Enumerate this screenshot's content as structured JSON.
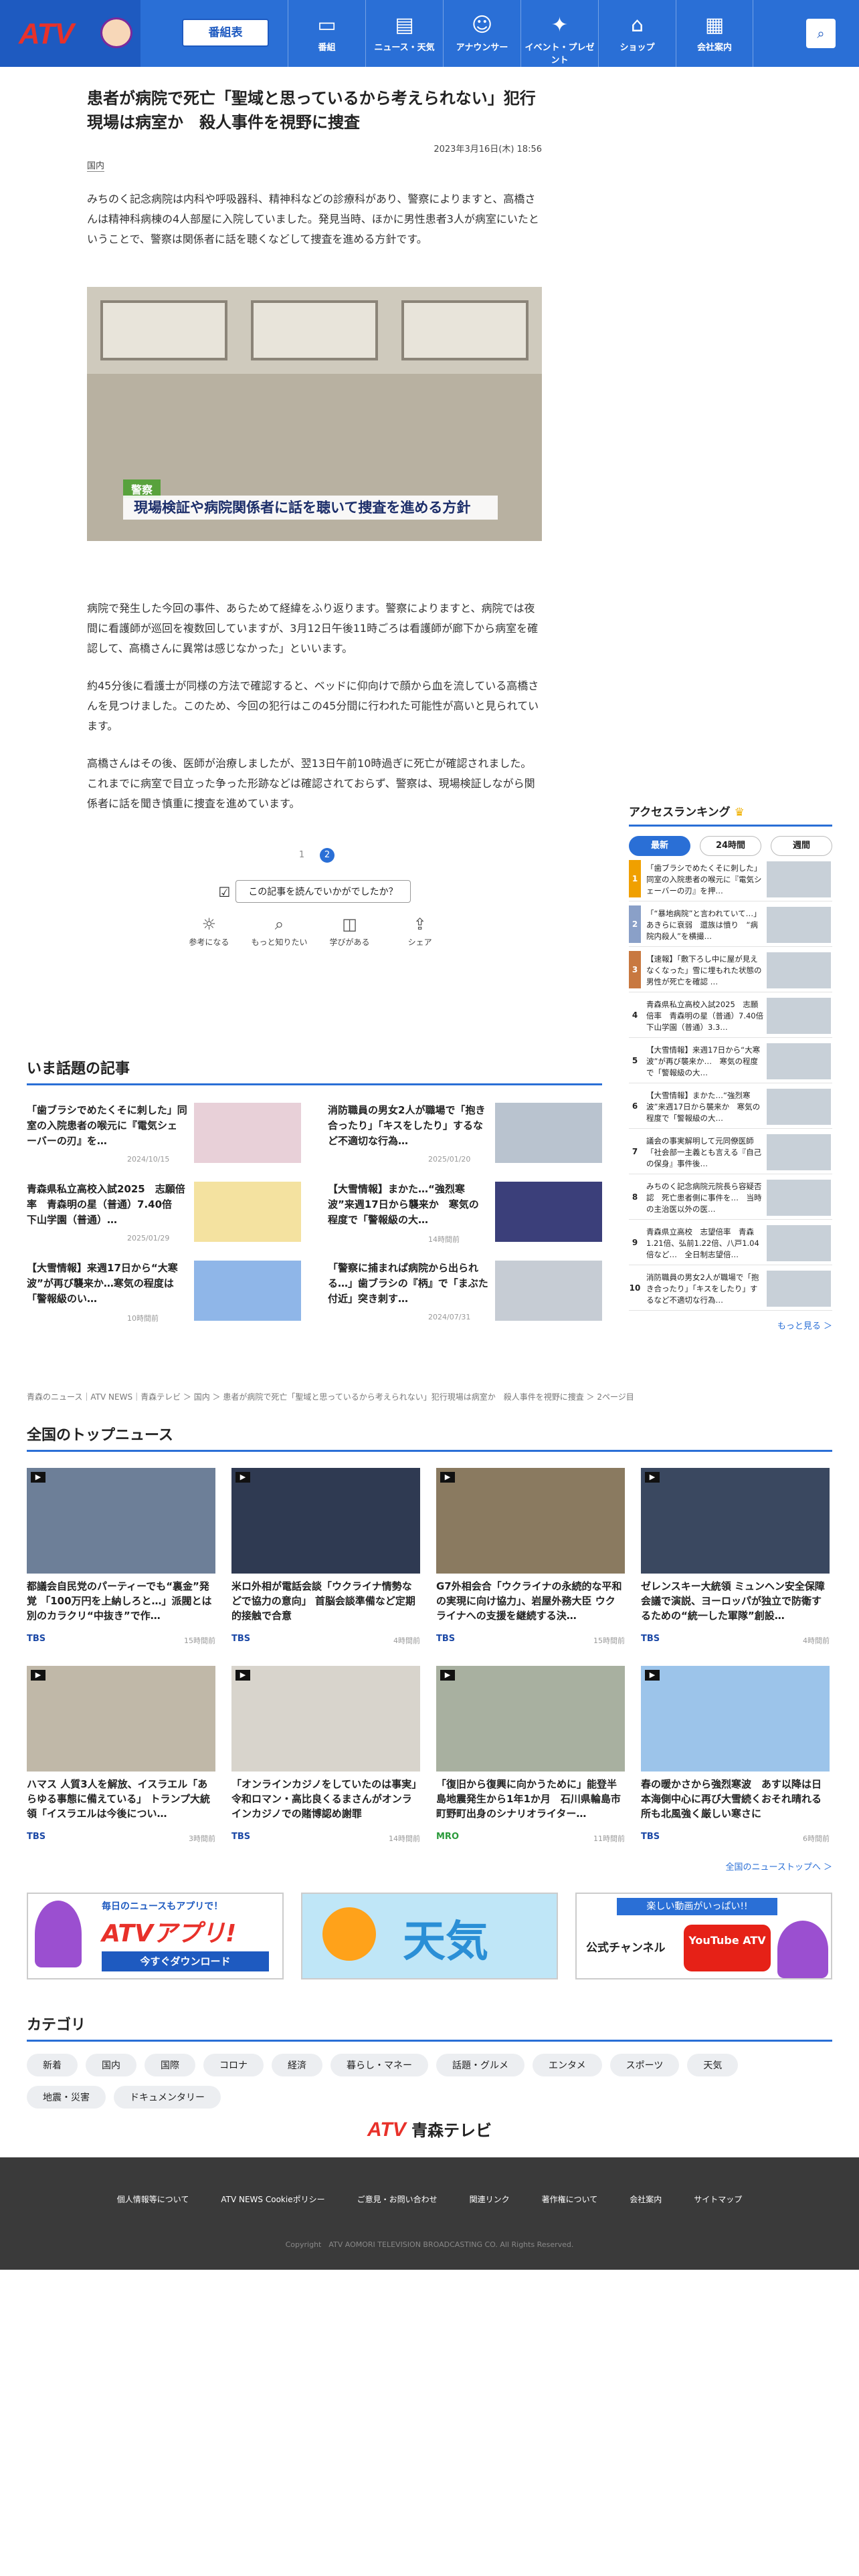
{
  "header": {
    "logo": "ATV",
    "program_button": "番組表",
    "nav": [
      {
        "label": "番組",
        "icon": "tv-icon"
      },
      {
        "label": "ニュース・天気",
        "icon": "news-icon"
      },
      {
        "label": "アナウンサー",
        "icon": "announcer-icon"
      },
      {
        "label": "イベント・プレゼント",
        "icon": "event-icon"
      },
      {
        "label": "ショップ",
        "icon": "shop-icon"
      },
      {
        "label": "会社案内",
        "icon": "building-icon"
      }
    ],
    "search_icon": "search-icon"
  },
  "article": {
    "title": "患者が病院で死亡「聖域と思っているから考えられない」犯行現場は病室か　殺人事件を視野に捜査",
    "date": "2023年3月16日(木) 18:56",
    "category": "国内",
    "para1": "みちのく記念病院は内科や呼吸器科、精神科などの診療科があり、警察によりますと、高橋さんは精神科病棟の4人部屋に入院していました。発見当時、ほかに男性患者3人が病室にいたということで、警察は関係者に話を聴くなどして捜査を進める方針です。",
    "photo_tag": "警察",
    "photo_caption": "現場検証や病院関係者に話を聴いて捜査を進める方針",
    "para2": "病院で発生した今回の事件、あらためて経緯をふり返ります。警察によりますと、病院では夜間に看護師が巡回を複数回していますが、3月12日午後11時ごろは看護師が廊下から病室を確認して、高橋さんに異常は感じなかった」といいます。",
    "para3": "約45分後に看護士が同様の方法で確認すると、ベッドに仰向けで顔から血を流している高橋さんを見つけました。このため、今回の犯行はこの45分間に行われた可能性が高いと見られています。",
    "para4": "高橋さんはその後、医師が治療しましたが、翌13日午前10時過ぎに死亡が確認されました。これまでに病室で目立った争った形跡などは確認されておらず、警察は、現場検証しながら関係者に話を聞き慎重に捜査を進めています。",
    "pages": [
      "1",
      "2"
    ],
    "question": "この記事を読んでいかがでしたか？",
    "reactions": [
      "参考になる",
      "もっと知りたい",
      "学びがある",
      "シェア"
    ]
  },
  "ima": {
    "title": "いま話題の記事",
    "items": [
      {
        "title": "「歯ブラシでめたくそに刺した」同室の入院患者の喉元に『電気シェーバーの刃』を…",
        "date": "2024/10/15"
      },
      {
        "title": "消防職員の男女2人が職場で「抱き合ったり」「キスをしたり」するなど不適切な行為…",
        "date": "2025/01/20"
      },
      {
        "title": "青森県私立高校入試2025　志願倍率　青森明の星（普通）7.40倍　下山学園（普通）…",
        "date": "2025/01/29"
      },
      {
        "title": "【大雪情報】まかた…“強烈寒波”来週17日から襲来か　寒気の程度で「警報級の大…",
        "date": "14時間前"
      },
      {
        "title": "【大雪情報】来週17日から“大寒波”が再び襲来か…寒気の程度は「警報級のい…",
        "date": "10時間前"
      },
      {
        "title": "「警察に捕まれば病院から出られる…」歯ブラシの『柄』で「まぶた付近」突き刺す…",
        "date": "2024/07/31"
      }
    ]
  },
  "breadcrumb": "青森のニュース｜ATV NEWS｜青森テレビ ＞ 国内 ＞ 患者が病院で死亡「聖域と思っているから考えられない」犯行現場は病室か　殺人事件を視野に捜査 ＞ 2ページ目",
  "ranking": {
    "title": "アクセスランキング",
    "tabs": [
      "最新",
      "24時間",
      "週間"
    ],
    "items": [
      {
        "n": "1",
        "title": "「歯ブラシでめたくそに刺した」同室の入院患者の喉元に『電気シェーバーの刃』を押…"
      },
      {
        "n": "2",
        "title": "「“暴地病院”と言われていて…」あきらに衰弱　還族は憤り　“病院内殺人”を横撮…"
      },
      {
        "n": "3",
        "title": "【速報】「敷下ろし中に屋が見えなくなった」雪に埋もれた状態の男性が死亡を確認 …"
      },
      {
        "n": "4",
        "title": "青森県私立高校入試2025　志願倍率　青森明の星（普通）7.40倍　下山学園（普通）3.3…"
      },
      {
        "n": "5",
        "title": "【大雪情報】来週17日から“大寒波”が再び襲来か…　寒気の程度で「警報級の大…"
      },
      {
        "n": "6",
        "title": "【大雪情報】まかた…“強烈寒波”来週17日から襲来か　寒気の程度で「警報級の大…"
      },
      {
        "n": "7",
        "title": "議会の事実解明して元同僚医師「社会部一主義とも言える『自己の保身』事件後…"
      },
      {
        "n": "8",
        "title": "みちのく記念病院元院長ら容疑否認　死亡患者側に事件を…　当時の主治医以外の医…"
      },
      {
        "n": "9",
        "title": "青森県立高校　志望倍率　青森1.21倍、弘前1.22倍、八戸1.04倍など…　全日制志望倍…"
      },
      {
        "n": "10",
        "title": "消防職員の男女2人が職場で「抱き合ったり」「キスをしたり」するなど不適切な行為…"
      }
    ],
    "more": "もっと見る ＞"
  },
  "top": {
    "title": "全国のトップニュース",
    "items": [
      {
        "title": "都議会自民党のパーティーでも“裏金”発覚 「100万円を上納しろと…」派閥とは別のカラクリ“中抜き”で作…",
        "src": "TBS",
        "date": "15時間前"
      },
      {
        "title": "米ロ外相が電話会談「ウクライナ情勢などで協力の意向」 首脳会談準備など定期的接触で合意",
        "src": "TBS",
        "date": "4時間前"
      },
      {
        "title": "G7外相会合「ウクライナの永続的な平和の実現に向け協力」、岩屋外務大臣 ウクライナへの支援を継続する決…",
        "src": "TBS",
        "date": "15時間前"
      },
      {
        "title": "ゼレンスキー大統領 ミュンヘン安全保障会議で演説、ヨーロッパが独立で防衛するための“統一した軍隊”創設…",
        "src": "TBS",
        "date": "4時間前"
      },
      {
        "title": "ハマス 人質3人を解放、イスラエル「あらゆる事態に備えている」 トランプ大統領「イスラエルは今後につい…",
        "src": "TBS",
        "date": "3時間前"
      },
      {
        "title": "「オンラインカジノをしていたのは事実」令和ロマン・高比良くるまさんがオンラインカジノでの賭博認め謝罪",
        "src": "TBS",
        "date": "14時間前"
      },
      {
        "title": "「復旧から復興に向かうために」能登半島地震発生から1年1か月　石川県輪島市町野町出身のシナリオライター…",
        "src": "MRO",
        "date": "11時間前"
      },
      {
        "title": "春の暖かさから強烈寒波　あす以降は日本海側中心に再び大雪続くおそれ晴れる所も北風強く厳しい寒さに",
        "src": "TBS",
        "date": "6時間前"
      }
    ],
    "more": "全国のニューストップへ ＞"
  },
  "banners": [
    {
      "line1": "毎日のニュースもアプリで！",
      "line2": "ATVアプリ!",
      "line3": "今すぐダウンロード"
    },
    {
      "line1": "天気"
    },
    {
      "line1": "楽しい動画がいっぱい!!",
      "line2": "公式チャンネル",
      "line3": "YouTube ATV"
    }
  ],
  "categories": {
    "title": "カテゴリ",
    "items": [
      "新着",
      "国内",
      "国際",
      "コロナ",
      "経済",
      "暮らし・マネー",
      "話題・グルメ",
      "エンタメ",
      "スポーツ",
      "天気",
      "地震・災害",
      "ドキュメンタリー"
    ]
  },
  "footer": {
    "logo": "ATV",
    "logo_sub": "青森テレビ",
    "links": [
      "個人情報等について",
      "ATV NEWS Cookieポリシー",
      "ご意見・お問い合わせ",
      "関連リンク",
      "著作権について",
      "会社案内",
      "サイトマップ"
    ],
    "copyright": "Copyright　ATV AOMORI TELEVISION BROADCASTING CO. All Rights Reserved."
  }
}
